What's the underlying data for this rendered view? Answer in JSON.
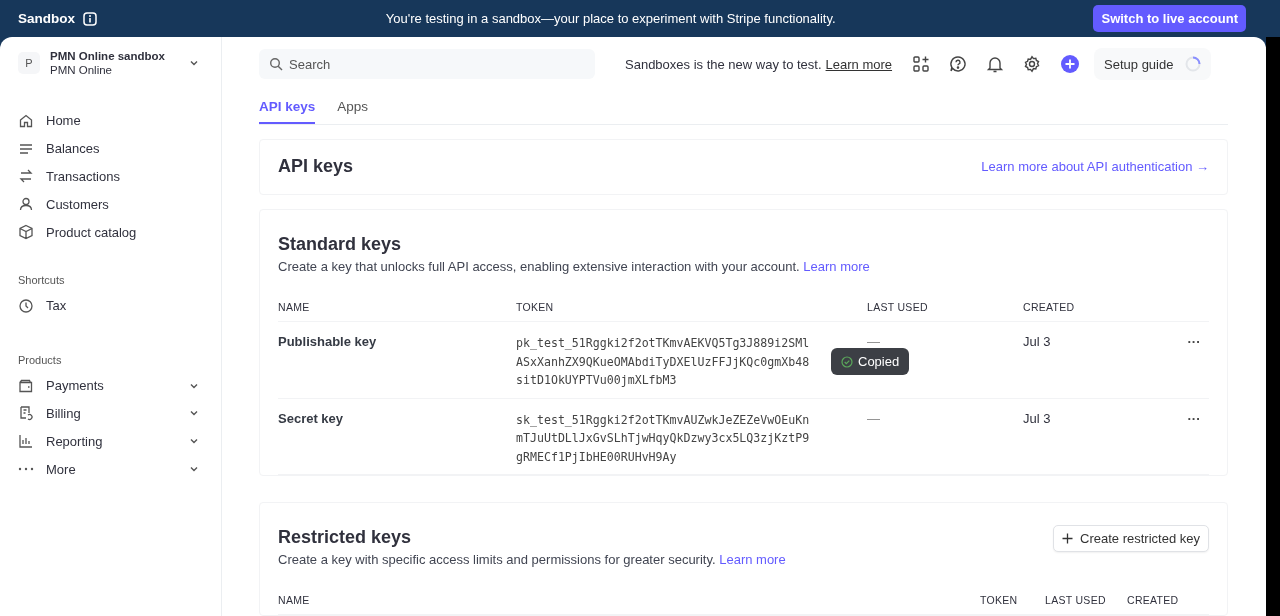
{
  "banner": {
    "label": "Sandbox",
    "message": "You're testing in a sandbox—your place to experiment with Stripe functionality.",
    "button": "Switch to live account"
  },
  "account": {
    "initial": "P",
    "name": "PMN Online sandbox",
    "subtitle": "PMN Online"
  },
  "sidebar": {
    "items": [
      {
        "label": "Home"
      },
      {
        "label": "Balances"
      },
      {
        "label": "Transactions"
      },
      {
        "label": "Customers"
      },
      {
        "label": "Product catalog"
      }
    ],
    "shortcuts": {
      "title": "Shortcuts",
      "items": [
        {
          "label": "Tax"
        }
      ]
    },
    "products": {
      "title": "Products",
      "items": [
        {
          "label": "Payments",
          "expanded": false
        },
        {
          "label": "Billing",
          "expanded": false
        },
        {
          "label": "Reporting",
          "expanded": false
        },
        {
          "label": "More",
          "expanded": false
        }
      ]
    }
  },
  "topbar": {
    "search": {
      "placeholder": "Search"
    },
    "notice": "Sandboxes is the new way to test.",
    "notice_link": "Learn more",
    "setup_guide": "Setup guide"
  },
  "tabs": [
    {
      "label": "API keys",
      "selected": true
    },
    {
      "label": "Apps",
      "selected": false
    }
  ],
  "header": {
    "title": "API keys",
    "link": "Learn more about API authentication →"
  },
  "standard_keys": {
    "title": "Standard keys",
    "description": "Create a key that unlocks full API access, enabling extensive interaction with your account.",
    "link": "Learn more",
    "columns": [
      "NAME",
      "TOKEN",
      "LAST USED",
      "CREATED"
    ],
    "rows": [
      {
        "name": "Publishable key",
        "token": "pk_test_51Rggki2f2otTKmvAEKVQ5Tg3J889i2SMlASxXanhZX9QKueOMAbdiTyDXElUzFFJjKQc0gmXb48sitD1OkUYPTVu00jmXLfbM3",
        "last_used": "—",
        "created": "Jul 3",
        "menu": "···"
      },
      {
        "name": "Secret key",
        "token": "sk_test_51Rggki2f2otTKmvAUZwkJeZEZeVwOEuKnmTJuUtDLlJxGvSLhTjwHqyQkDzwy3cx5LQ3zjKztP9gRMECf1PjIbHE00RUHvH9Ay",
        "last_used": "—",
        "created": "Jul 3",
        "menu": "···"
      }
    ],
    "tooltip": "Copied"
  },
  "restricted_keys": {
    "title": "Restricted keys",
    "description": "Create a key with specific access limits and permissions for greater security.",
    "link": "Learn more",
    "button": "Create restricted key",
    "columns": [
      "NAME",
      "TOKEN",
      "LAST USED",
      "CREATED"
    ]
  }
}
